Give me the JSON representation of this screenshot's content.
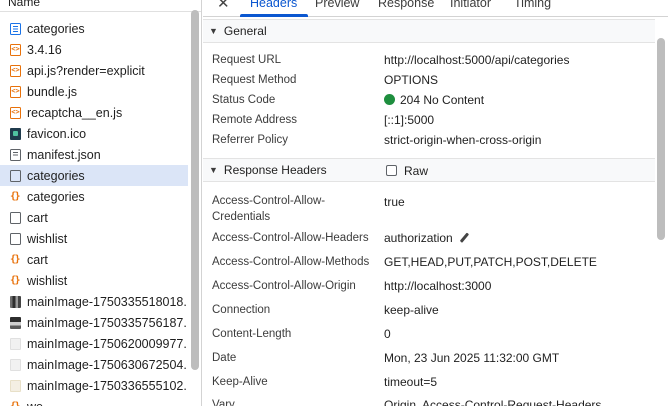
{
  "request_list": {
    "header": "Name",
    "items": [
      {
        "name": "categories",
        "icon": "document-icon",
        "selected": false
      },
      {
        "name": "3.4.16",
        "icon": "script-icon",
        "selected": false
      },
      {
        "name": "api.js?render=explicit",
        "icon": "script-icon",
        "selected": false
      },
      {
        "name": "bundle.js",
        "icon": "script-icon",
        "selected": false
      },
      {
        "name": "recaptcha__en.js",
        "icon": "script-icon",
        "selected": false
      },
      {
        "name": "favicon.ico",
        "icon": "favicon-icon",
        "selected": false
      },
      {
        "name": "manifest.json",
        "icon": "manifest-icon",
        "selected": false
      },
      {
        "name": "categories",
        "icon": "preflight-icon",
        "selected": true
      },
      {
        "name": "categories",
        "icon": "fetch-icon",
        "selected": false
      },
      {
        "name": "cart",
        "icon": "preflight-icon",
        "selected": false
      },
      {
        "name": "wishlist",
        "icon": "preflight-icon",
        "selected": false
      },
      {
        "name": "cart",
        "icon": "fetch-icon",
        "selected": false
      },
      {
        "name": "wishlist",
        "icon": "fetch-icon",
        "selected": false
      },
      {
        "name": "mainImage-1750335518018...",
        "icon": "image-icon",
        "selected": false
      },
      {
        "name": "mainImage-1750335756187...",
        "icon": "image-icon",
        "selected": false
      },
      {
        "name": "mainImage-1750620009977...",
        "icon": "image-icon",
        "selected": false
      },
      {
        "name": "mainImage-1750630672504...",
        "icon": "image-icon",
        "selected": false
      },
      {
        "name": "mainImage-1750336555102...",
        "icon": "image-icon",
        "selected": false
      },
      {
        "name": "we",
        "icon": "fetch-icon",
        "selected": false
      }
    ]
  },
  "tabs": {
    "close": "✕",
    "items": [
      "Headers",
      "Preview",
      "Response",
      "Initiator",
      "Timing"
    ],
    "active": "Headers"
  },
  "general": {
    "title": "General",
    "rows": [
      {
        "key": "Request URL",
        "value": "http://localhost:5000/api/categories"
      },
      {
        "key": "Request Method",
        "value": "OPTIONS"
      },
      {
        "key": "Status Code",
        "value": "204 No Content"
      },
      {
        "key": "Remote Address",
        "value": "[::1]:5000"
      },
      {
        "key": "Referrer Policy",
        "value": "strict-origin-when-cross-origin"
      }
    ]
  },
  "response_headers": {
    "title": "Response Headers",
    "raw_label": "Raw",
    "rows": [
      {
        "key": "Access-Control-Allow-Credentials",
        "value": "true"
      },
      {
        "key": "Access-Control-Allow-Headers",
        "value": "authorization"
      },
      {
        "key": "Access-Control-Allow-Methods",
        "value": "GET,HEAD,PUT,PATCH,POST,DELETE"
      },
      {
        "key": "Access-Control-Allow-Origin",
        "value": "http://localhost:3000"
      },
      {
        "key": "Connection",
        "value": "keep-alive"
      },
      {
        "key": "Content-Length",
        "value": "0"
      },
      {
        "key": "Date",
        "value": "Mon, 23 Jun 2025 11:32:00 GMT"
      },
      {
        "key": "Keep-Alive",
        "value": "timeout=5"
      },
      {
        "key": "Vary",
        "value": "Origin, Access-Control-Request-Headers"
      }
    ]
  },
  "colors": {
    "accent": "#0b57d0",
    "status_ok": "#1e8e3e",
    "selected_row": "#dbe5f7"
  }
}
